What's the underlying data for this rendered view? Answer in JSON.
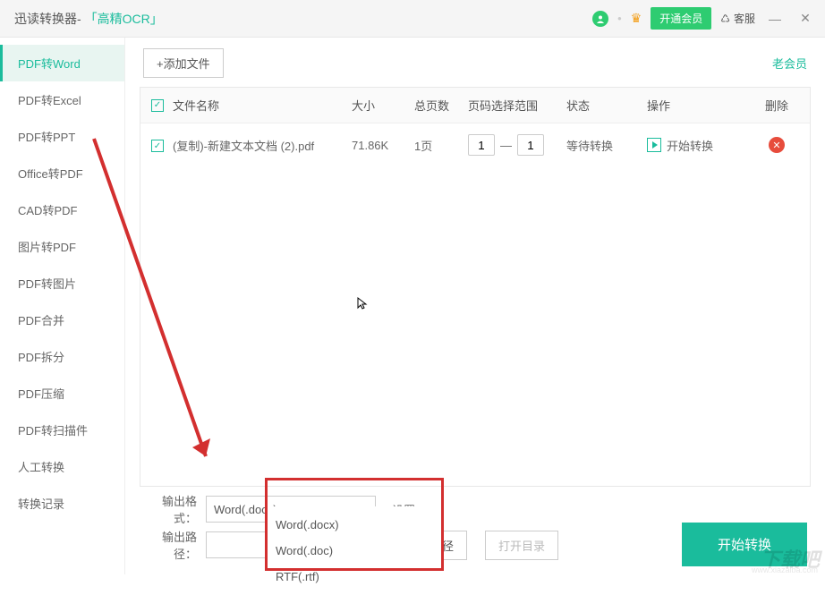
{
  "titlebar": {
    "app_name": "迅读转换器",
    "separator": " - ",
    "ocr_label": "「高精OCR」",
    "vip_button": "开通会员",
    "service_button": "客服"
  },
  "sidebar": {
    "items": [
      {
        "label": "PDF转Word"
      },
      {
        "label": "PDF转Excel"
      },
      {
        "label": "PDF转PPT"
      },
      {
        "label": "Office转PDF"
      },
      {
        "label": "CAD转PDF"
      },
      {
        "label": "图片转PDF"
      },
      {
        "label": "PDF转图片"
      },
      {
        "label": "PDF合并"
      },
      {
        "label": "PDF拆分"
      },
      {
        "label": "PDF压缩"
      },
      {
        "label": "PDF转扫描件"
      },
      {
        "label": "人工转换"
      },
      {
        "label": "转换记录"
      }
    ]
  },
  "toolbar": {
    "add_file": "+添加文件",
    "old_member": "老会员"
  },
  "table": {
    "headers": {
      "name": "文件名称",
      "size": "大小",
      "pages": "总页数",
      "range": "页码选择范围",
      "status": "状态",
      "action": "操作",
      "delete": "删除"
    },
    "rows": [
      {
        "name": "(复制)-新建文本文档 (2).pdf",
        "size": "71.86K",
        "pages": "1页",
        "range_from": "1",
        "range_to": "1",
        "range_sep": "—",
        "status": "等待转换",
        "action": "开始转换"
      }
    ]
  },
  "footer": {
    "format_label": "输出格式：",
    "format_value": "Word(.docx)",
    "settings": "设置",
    "path_label": "输出路径：",
    "choose_path": "选择路径",
    "open_dir": "打开目录",
    "convert": "开始转换"
  },
  "dropdown": {
    "options": [
      {
        "label": "Word(.docx)"
      },
      {
        "label": "Word(.doc)"
      },
      {
        "label": "RTF(.rtf)"
      }
    ]
  },
  "watermark": "下载吧",
  "watermark_url": "www.xiazaiba.com"
}
